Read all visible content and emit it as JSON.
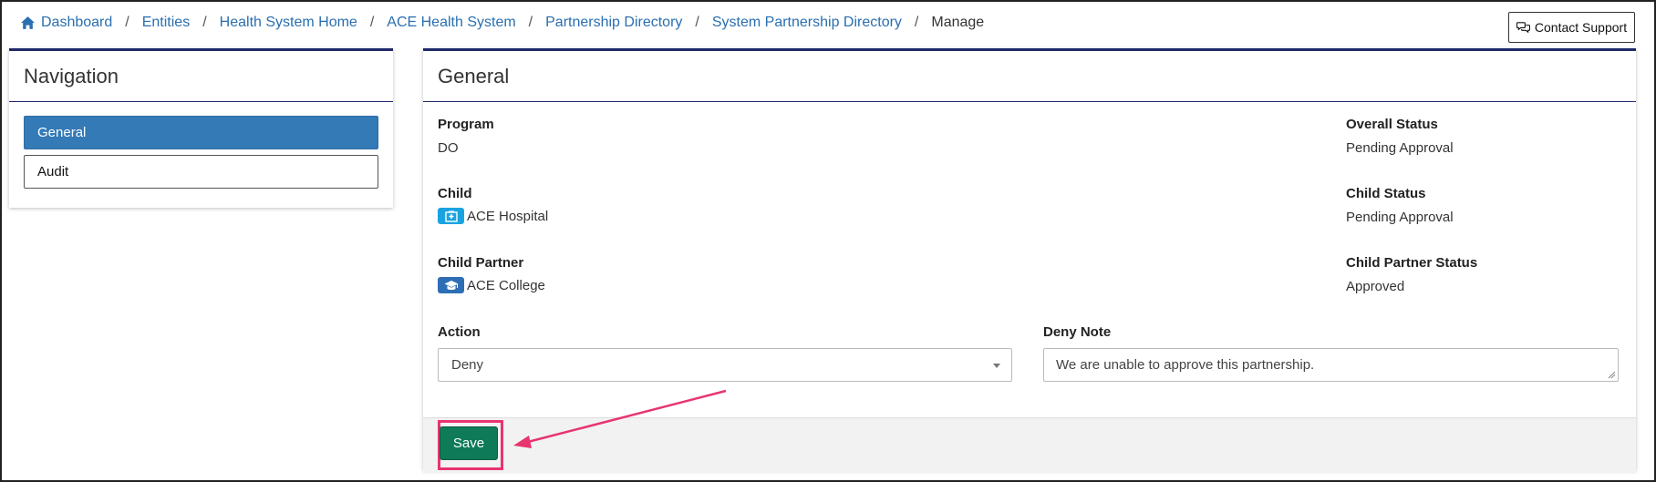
{
  "breadcrumb": {
    "items": [
      "Dashboard",
      "Entities",
      "Health System Home",
      "ACE Health System",
      "Partnership Directory",
      "System Partnership Directory"
    ],
    "current": "Manage",
    "separator": "/"
  },
  "contact_support": {
    "label": "Contact Support"
  },
  "navigation": {
    "title": "Navigation",
    "items": [
      {
        "label": "General",
        "active": true
      },
      {
        "label": "Audit",
        "active": false
      }
    ]
  },
  "general": {
    "title": "General",
    "program": {
      "label": "Program",
      "value": "DO"
    },
    "overall_status": {
      "label": "Overall Status",
      "value": "Pending Approval"
    },
    "child": {
      "label": "Child",
      "value": "ACE Hospital",
      "icon": "hospital-icon"
    },
    "child_status": {
      "label": "Child Status",
      "value": "Pending Approval"
    },
    "child_partner": {
      "label": "Child Partner",
      "value": "ACE College",
      "icon": "graduation-cap-icon"
    },
    "child_partner_status": {
      "label": "Child Partner Status",
      "value": "Approved"
    },
    "action": {
      "label": "Action",
      "value": "Deny"
    },
    "deny_note": {
      "label": "Deny Note",
      "value": "We are unable to approve this partnership."
    },
    "save_label": "Save"
  },
  "colors": {
    "link": "#2a6fb0",
    "panel_border": "#1f2a6b",
    "active_nav": "#337ab7",
    "save_button": "#0e7a58",
    "annotation": "#e8346f"
  }
}
